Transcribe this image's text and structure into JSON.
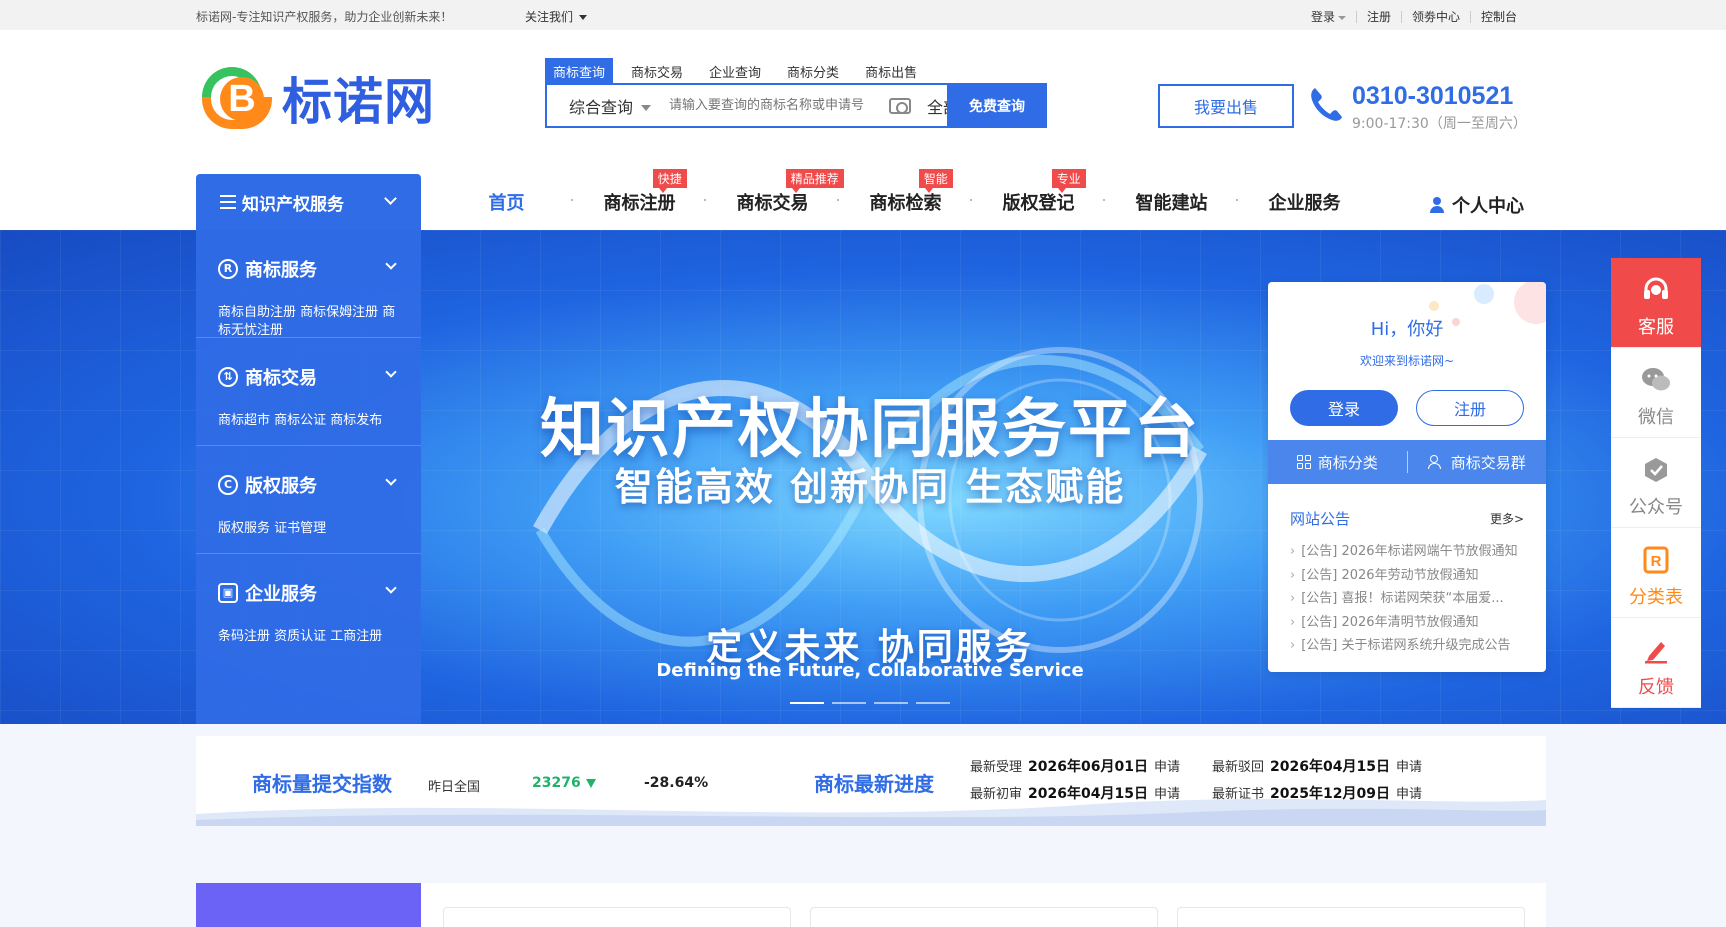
{
  "topbar": {
    "slogan": "标诺网-专注知识产权服务，助力企业创新未来！",
    "follow": "关注我们",
    "login": "登录",
    "register": "注册",
    "coupon": "领劵中心",
    "console": "控制台"
  },
  "logo": {
    "text": "标诺网",
    "mark": "B"
  },
  "search": {
    "tabs": [
      "商标查询",
      "商标交易",
      "企业查询",
      "商标分类",
      "商标出售"
    ],
    "type": "综合查询",
    "placeholder": "请输入要查询的商标名称或申请号",
    "category": "全部分类",
    "button": "免费查询"
  },
  "sell_button": "我要出售",
  "contact": {
    "phone": "0310-3010521",
    "hours": "9:00-17:30（周一至周六）"
  },
  "nav": {
    "category_title": "知识产权服务",
    "items": [
      {
        "label": "首页",
        "badge": ""
      },
      {
        "label": "商标注册",
        "badge": "快捷"
      },
      {
        "label": "商标交易",
        "badge": "精品推荐"
      },
      {
        "label": "商标检索",
        "badge": "智能"
      },
      {
        "label": "版权登记",
        "badge": "专业"
      },
      {
        "label": "智能建站",
        "badge": ""
      },
      {
        "label": "企业服务",
        "badge": ""
      }
    ],
    "personal": "个人中心"
  },
  "categories": [
    {
      "icon": "R",
      "title": "商标服务",
      "links": "商标自助注册 商标保姆注册 商标无忧注册"
    },
    {
      "icon": "⇅",
      "title": "商标交易",
      "links": "商标超市 商标公证 商标发布"
    },
    {
      "icon": "C",
      "title": "版权服务",
      "links": "版权服务 证书管理"
    },
    {
      "icon": "▣",
      "title": "企业服务",
      "links": "条码注册 资质认证 工商注册"
    }
  ],
  "banner": {
    "title": "知识产权协同服务平台",
    "subtitle": "智能高效 创新协同 生态赋能",
    "tagline": "定义未来 协同服务",
    "tagline_en": "Defining the Future, Collaborative Service"
  },
  "login_card": {
    "hi": "Hi，你好",
    "welcome": "欢迎来到标诺网~",
    "login": "登录",
    "register": "注册",
    "classify": "商标分类",
    "group": "商标交易群",
    "notice_title": "网站公告",
    "more": "更多>",
    "notices": [
      "[公告] 2026年标诺网端午节放假通知",
      "[公告] 2026年劳动节放假通知",
      "[公告] 喜报！标诺网荣获“本届爱...",
      "[公告] 2026年清明节放假通知",
      "[公告] 关于标诺网系统升级完成公告"
    ]
  },
  "floatbar": [
    "客服",
    "微信",
    "公众号",
    "分类表",
    "反馈"
  ],
  "stats": {
    "index_title": "商标量提交指数",
    "yesterday": "昨日全国",
    "count": "23276",
    "percent": "-28.64%",
    "progress_title": "商标最新进度",
    "progress": [
      {
        "label": "最新受理",
        "date": "2026年06月01日",
        "suffix": "申请"
      },
      {
        "label": "最新驳回",
        "date": "2026年04月15日",
        "suffix": "申请"
      },
      {
        "label": "最新初审",
        "date": "2026年04月15日",
        "suffix": "申请"
      },
      {
        "label": "最新证书",
        "date": "2025年12月09日",
        "suffix": "申请"
      }
    ]
  },
  "colors": {
    "primary": "#2f6ce5",
    "accent_red": "#f04a4a",
    "accent_green": "#1fb36b",
    "accent_orange": "#ff8a1a",
    "purple": "#6b63f6"
  }
}
